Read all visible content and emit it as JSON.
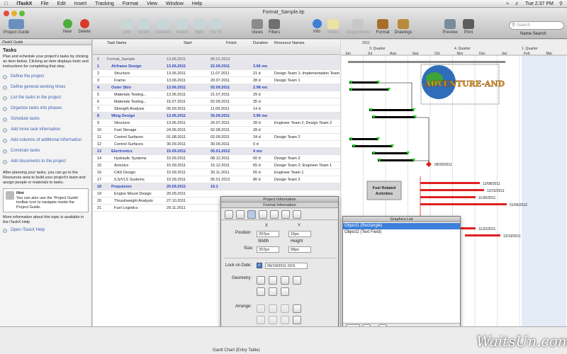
{
  "menubar": {
    "app": "iTaskX",
    "items": [
      "File",
      "Edit",
      "Insert",
      "Tracking",
      "Format",
      "View",
      "Window",
      "Help"
    ],
    "clock": "Tue 2:37 PM"
  },
  "window": {
    "title": "Format_Sample.itp",
    "toolbar": {
      "project_guide": "Project Guide",
      "new": "New",
      "delete": "Delete",
      "link": "Link",
      "unlink": "Unlink",
      "outdent": "Outdent",
      "indent": "Indent",
      "split": "Split",
      "goto": "Go To",
      "views": "Views",
      "filters": "Filters",
      "info": "Info",
      "notes": "Notes",
      "assignments": "Assignments",
      "format": "Format",
      "drawings": "Drawings",
      "preview": "Preview",
      "print": "Print",
      "search_placeholder": "Search",
      "name_search": "Name Search"
    }
  },
  "sidebar": {
    "header": "iTaskX Guide",
    "title": "Tasks",
    "intro": "Plan and schedule your project's tasks by clicking an item below. Clicking an item displays tools and instructions for completing that step.",
    "items": [
      "Define the project",
      "Define general working times",
      "List the tasks in the project",
      "Organize tasks into phases",
      "Schedule tasks",
      "Add more task information",
      "Add columns of additional information",
      "Constrain tasks",
      "Add documents to the project"
    ],
    "after_text": "After planning your tasks, you can go to the Resources area to build your project's team and assign people or materials to tasks.",
    "hint_title": "Hint",
    "hint_text": "You can also use the 'Project Guide' toolbar icon to navigate inside the Project Guide.",
    "more_info": "More information about this topic is available in the iTaskX Help",
    "open_help": "Open iTaskX Help"
  },
  "table": {
    "headers": {
      "name": "Task Name",
      "start": "Start",
      "finish": "Finish",
      "duration": "Duration",
      "resources": "Resource Names"
    },
    "rows": [
      {
        "id": "0",
        "name": "Format_Sample",
        "start": "13.06.2011",
        "finish": "05.01.2012",
        "dur": "",
        "res": "",
        "type": "root"
      },
      {
        "id": "1",
        "name": "Airframe Design",
        "start": "13.06.2011",
        "finish": "22.09.2011",
        "dur": "3.66 mo",
        "res": "",
        "type": "sum"
      },
      {
        "id": "2",
        "name": "Structure",
        "start": "13.06.2011",
        "finish": "11.07.2011",
        "dur": "21 d",
        "res": "Design Team 1; Implementation Team 1",
        "type": "task"
      },
      {
        "id": "3",
        "name": "Frame",
        "start": "13.06.2011",
        "finish": "20.07.2011",
        "dur": "28 d",
        "res": "Design Team 1",
        "type": "task"
      },
      {
        "id": "4",
        "name": "Outer Skin",
        "start": "13.06.2011",
        "finish": "02.09.2011",
        "dur": "2.98 mo",
        "res": "",
        "type": "sum"
      },
      {
        "id": "5",
        "name": "Materials Testing...",
        "start": "13.06.2011",
        "finish": "21.07.2011",
        "dur": "29 d",
        "res": "",
        "type": "task"
      },
      {
        "id": "6",
        "name": "Materials Testing...",
        "start": "15.07.2011",
        "finish": "02.09.2011",
        "dur": "35 d",
        "res": "",
        "type": "task"
      },
      {
        "id": "7",
        "name": "Strength Analysis",
        "start": "05.09.2011",
        "finish": "11.09.2011",
        "dur": "14 d",
        "res": "",
        "type": "task"
      },
      {
        "id": "8",
        "name": "Wing Design",
        "start": "13.06.2011",
        "finish": "30.09.2011",
        "dur": "3.96 mo",
        "res": "",
        "type": "sum"
      },
      {
        "id": "9",
        "name": "Structure",
        "start": "13.06.2011",
        "finish": "20.07.2011",
        "dur": "28 d",
        "res": "Engineer Team 2; Design Team 2",
        "type": "task"
      },
      {
        "id": "10",
        "name": "Fuel Storage",
        "start": "24.06.2011",
        "finish": "02.08.2011",
        "dur": "28 d",
        "res": "",
        "type": "task"
      },
      {
        "id": "11",
        "name": "Control Surfaces",
        "start": "01.08.2011",
        "finish": "02.09.2011",
        "dur": "24 d",
        "res": "Design Team 2",
        "type": "task"
      },
      {
        "id": "12",
        "name": "Control Surfaces",
        "start": "30.09.2011",
        "finish": "30.09.2011",
        "dur": "0 d",
        "res": "",
        "type": "task"
      },
      {
        "id": "13",
        "name": "Electronics",
        "start": "15.09.2011",
        "finish": "05.01.2012",
        "dur": "4 mo",
        "res": "",
        "type": "sum"
      },
      {
        "id": "14",
        "name": "Hydraulic Systems",
        "start": "15.09.2011",
        "finish": "08.12.2011",
        "dur": "60 d",
        "res": "Design Team 2",
        "type": "task"
      },
      {
        "id": "15",
        "name": "Avionics",
        "start": "15.09.2011",
        "finish": "15.12.2011",
        "dur": "65 d",
        "res": "Design Team 2; Engineer Team 1",
        "type": "task"
      },
      {
        "id": "16",
        "name": "CAS Design",
        "start": "15.09.2011",
        "finish": "30.11.2011",
        "dur": "55 d",
        "res": "Engineer Team 1",
        "type": "task"
      },
      {
        "id": "17",
        "name": "ILS/VLS Systems",
        "start": "15.09.2011",
        "finish": "05.01.2012",
        "dur": "80 d",
        "res": "Design Team 2",
        "type": "task"
      },
      {
        "id": "18",
        "name": "Propulsion",
        "start": "20.09.2011",
        "finish": "19.1",
        "dur": "",
        "res": "",
        "type": "sum"
      },
      {
        "id": "19",
        "name": "Engine Mount Design",
        "start": "20.09.2011",
        "finish": "",
        "dur": "",
        "res": "",
        "type": "task"
      },
      {
        "id": "20",
        "name": "Thrust/weight Analysis",
        "start": "27.10.2011",
        "finish": "",
        "dur": "",
        "res": "",
        "type": "task"
      },
      {
        "id": "21",
        "name": "Fuel Logistics",
        "start": "29.11.2011",
        "finish": "",
        "dur": "",
        "res": "",
        "type": "task"
      }
    ]
  },
  "gantt": {
    "year": "2011",
    "quarters": [
      "3. Quarter",
      "4. Quarter",
      "1. Quarter"
    ],
    "months": [
      "Jun",
      "Jul",
      "Aug",
      "Sep",
      "Oct",
      "Nov",
      "Dec",
      "Jan",
      "Feb",
      "Mar"
    ],
    "milestone_label": "09/30/2011",
    "bar_labels": [
      "12/08/2011",
      "12/15/2011",
      "11/30/2011",
      "01/05/2012",
      "11/22/2011",
      "12/19/2011"
    ],
    "callout": "Fuel Related Activities",
    "logo_text": "ADVENTURE-AND"
  },
  "project_info_panel": {
    "title": "Project Information",
    "subtitle": "Format Information",
    "x_label": "X",
    "y_label": "Y",
    "position_label": "Position:",
    "x_value": "207px",
    "y_value": "15px",
    "width_label": "Width",
    "height_label": "Height",
    "size_label": "Size:",
    "width_value": "207px",
    "height_value": "99px",
    "lock_label": "Lock on Date:",
    "lock_value": "09/19/2011 03:5",
    "geometry_label": "Geometry:",
    "arrange_label": "Arrange:"
  },
  "graphics_list": {
    "title": "Graphics List",
    "items": [
      "Object1 (Rectangle)",
      "Object2 (Text Field)"
    ]
  },
  "status": {
    "view_name": "Gantt Chart (Entry Table)"
  },
  "watermark": "WaitsUn.com",
  "colors": {
    "summary_text": "#2a46b8",
    "bar_black": "#000000",
    "bar_red": "#e02020",
    "milestone_green": "#22cc22",
    "selection": "#3d7fd9"
  }
}
